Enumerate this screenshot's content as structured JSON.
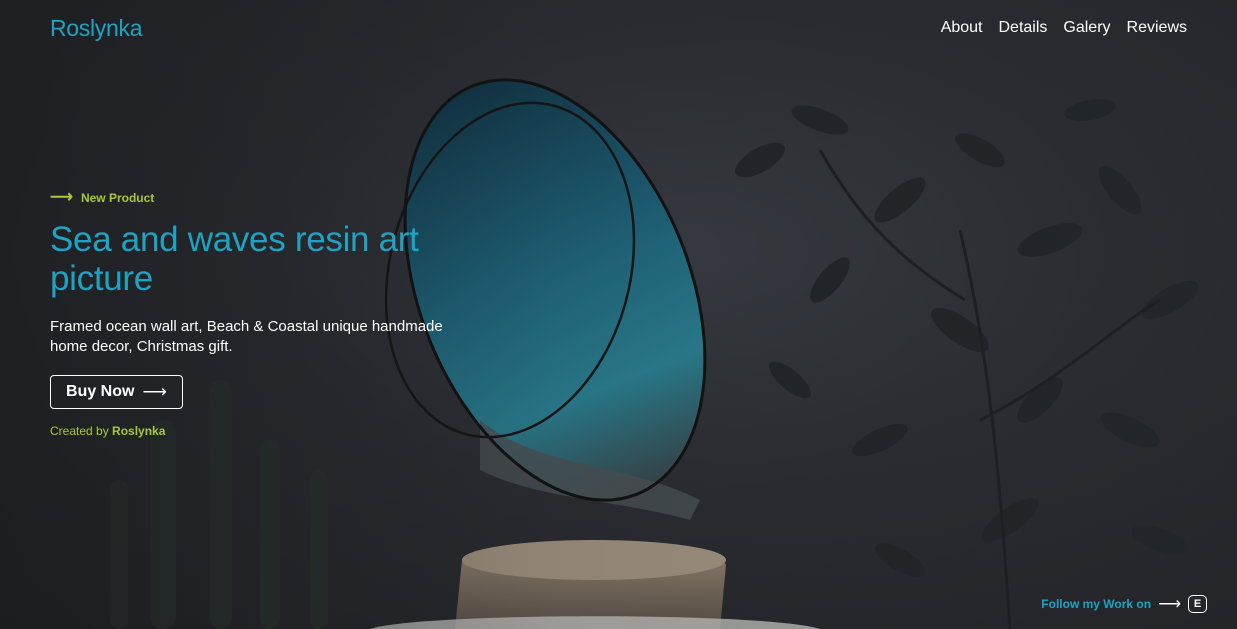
{
  "nav": {
    "logo": "Roslynka",
    "links": [
      {
        "label": "About"
      },
      {
        "label": "Details"
      },
      {
        "label": "Galery"
      },
      {
        "label": "Reviews"
      }
    ]
  },
  "hero": {
    "eyebrow": "New Product",
    "title": "Sea and waves resin art picture",
    "description": "Framed ocean wall art, Beach & Coastal unique handmade home decor, Christmas gift.",
    "cta_label": "Buy Now",
    "credit_prefix": "Created by",
    "credit_name": "Roslynka"
  },
  "footer": {
    "follow_text": "Follow my Work on",
    "etsy_icon_letter": "E"
  },
  "colors": {
    "accent": "#1ea3c2",
    "lime": "#a8c93a",
    "background": "#2a2c31"
  },
  "icons": {
    "eyebrow": "arrow-right-icon",
    "cta": "arrow-right-icon",
    "follow": "arrow-right-icon",
    "shop": "etsy-icon"
  }
}
